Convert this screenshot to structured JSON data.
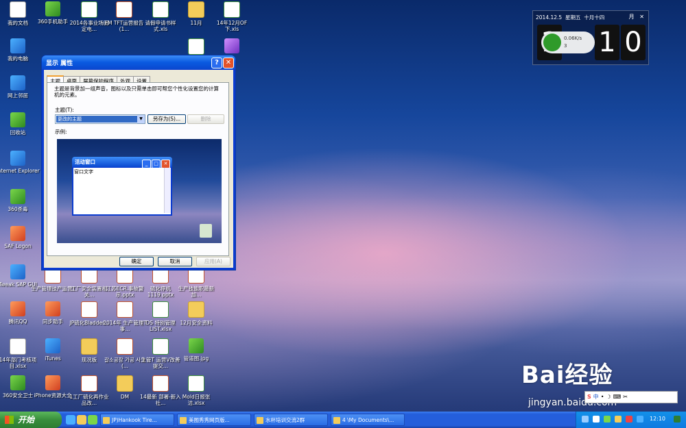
{
  "desktop_icons": [
    {
      "label": "我的文档"
    },
    {
      "label": "360手机助手"
    },
    {
      "label": "2014各事业场固定电..."
    },
    {
      "label": "FM TFT运营报告(1..."
    },
    {
      "label": "请假申请书样式.xls"
    },
    {
      "label": "11月"
    },
    {
      "label": "14年12月OF下.xls"
    },
    {
      "label": "我的电脑"
    },
    {
      "label": "网上邻居"
    },
    {
      "label": "回收站"
    },
    {
      "label": "Internet Explorer"
    },
    {
      "label": "360杀毒"
    },
    {
      "label": "SAF Logon"
    },
    {
      "label": "Tweak SAP GUI"
    },
    {
      "label": "生产管理技产运营!"
    },
    {
      "label": "工厂安全装置相关..."
    },
    {
      "label": "江苏ECR.事故警示.pptx"
    },
    {
      "label": "硫化停机1119.pptx"
    },
    {
      "label": "生产技能职最新加..."
    },
    {
      "label": "腾讯QQ"
    },
    {
      "label": "同步助手"
    },
    {
      "label": "JP硫化Bladder..."
    },
    {
      "label": "2014年 生产管理T 事..."
    },
    {
      "label": "DS 特别管理LIST.xlsx"
    },
    {
      "label": "12月安全资料"
    },
    {
      "label": "14年部门考核项目.xlsx"
    },
    {
      "label": "iTunes"
    },
    {
      "label": "现况板"
    },
    {
      "label": "갈소공장 가공 사고(..."
    },
    {
      "label": "生管T 运营V改善提交..."
    },
    {
      "label": "管道图.jpg"
    },
    {
      "label": "360安全卫士"
    },
    {
      "label": "iPhone资源大全"
    },
    {
      "label": "1工厂硫化再作业品改..."
    },
    {
      "label": "DM"
    },
    {
      "label": "14最新 部署-新入社..."
    },
    {
      "label": "Mold日报张洁.xlsx"
    }
  ],
  "dialog": {
    "title": "显示 属性",
    "tabs": [
      "主题",
      "桌面",
      "屏幕保护程序",
      "外观",
      "设置"
    ],
    "description": "主题是背景加一组声音，图标以及只需单击即可帮您个性化设置您的计算机的元素。",
    "theme_label": "主题(T):",
    "theme_value": "更改的主题",
    "save_as": "另存为(S)...",
    "delete": "删除",
    "example_label": "示例:",
    "preview_window_title": "活动窗口",
    "preview_window_text": "窗口文字",
    "ok": "确定",
    "cancel": "取消",
    "apply": "应用(A)"
  },
  "clock_widget": {
    "date": "2014.12.5",
    "weekday": "星期五",
    "lunar": "十月十四",
    "month_btn": "月",
    "hour_digit": "1",
    "minute_tens": "1",
    "minute_ones": "0",
    "net_down": "0.06K/s",
    "net_up": "3"
  },
  "watermark": {
    "brand": "Bai经验",
    "url": "jingyan.baidu.com"
  },
  "ime_bar": {
    "items": [
      "S",
      "中",
      "•",
      "☽",
      "⌨",
      "✂"
    ]
  },
  "taskbar": {
    "start_label": "开始",
    "tasks": [
      {
        "label": "JP)Hankook Tire..."
      },
      {
        "label": "美图秀秀网页版..."
      },
      {
        "label": "水杯培训交流2群"
      },
      {
        "label": "4 \\My Documents\\..."
      }
    ],
    "time": "12:10"
  },
  "colors": {
    "taskbar": "#245edb",
    "start": "#388e3c",
    "titlebar": "#0a5ae0",
    "dialog_bg": "#ece9d8"
  }
}
